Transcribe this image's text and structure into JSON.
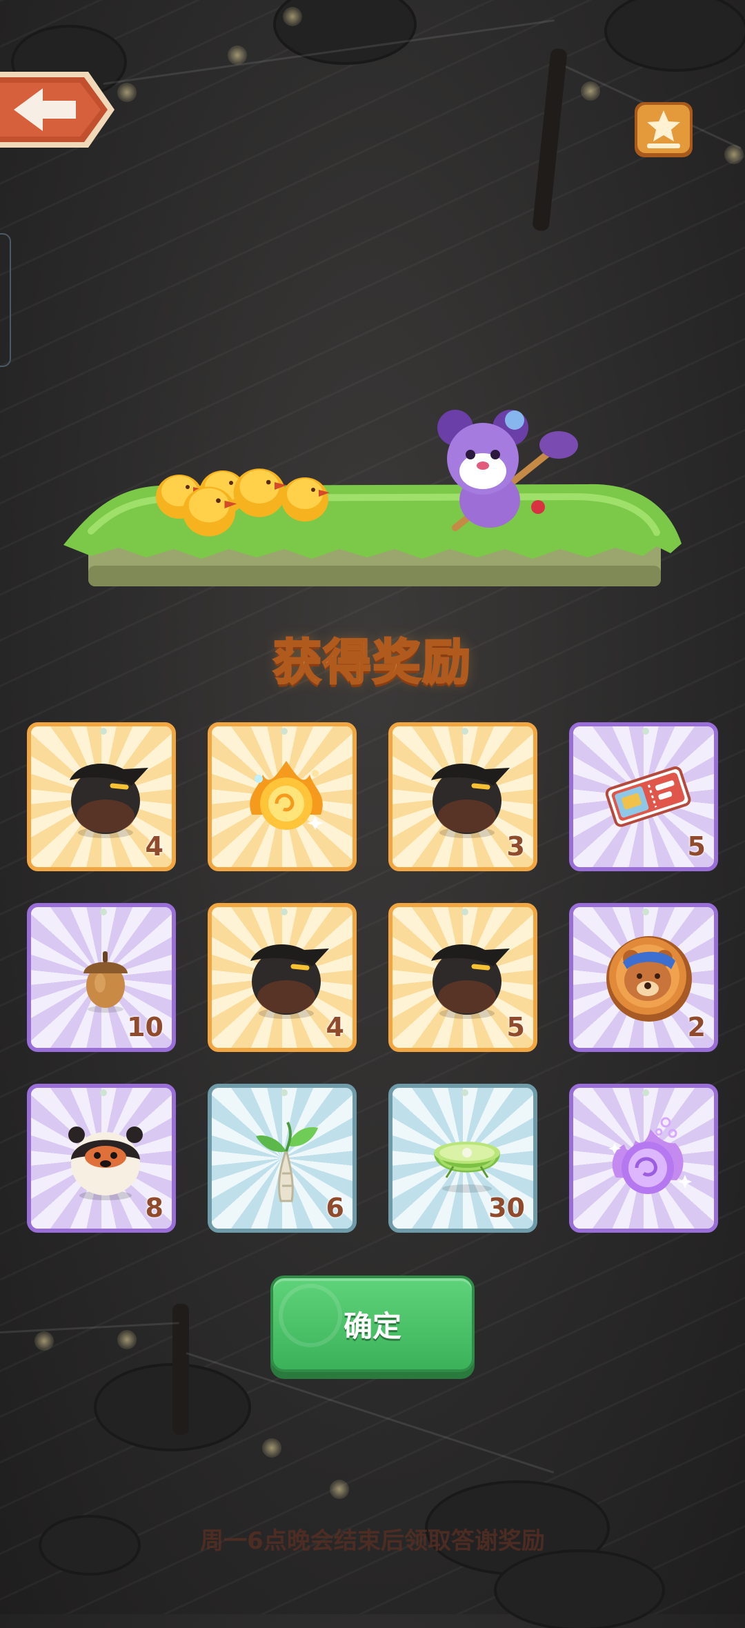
{
  "title": "获得奖励",
  "confirm_label": "确定",
  "footer_note": "周一6点晚会结束后领取答谢奖励",
  "colors": {
    "gold_border": "#f2a642",
    "purple_border": "#9a6ed8",
    "blue_border": "#6f9aa8",
    "confirm_green": "#4cc46a",
    "qty_text": "#8f4b2c"
  },
  "rewards": [
    {
      "icon": "black-bird-egg-icon",
      "tier": "gold",
      "qty": "4"
    },
    {
      "icon": "golden-flame-orb-icon",
      "tier": "gold",
      "qty": ""
    },
    {
      "icon": "black-bird-egg-icon",
      "tier": "gold",
      "qty": "3"
    },
    {
      "icon": "ticket-icon",
      "tier": "purple",
      "qty": "5"
    },
    {
      "icon": "acorn-icon",
      "tier": "purple",
      "qty": "10"
    },
    {
      "icon": "black-bird-egg-icon",
      "tier": "gold",
      "qty": "4"
    },
    {
      "icon": "black-bird-egg-icon",
      "tier": "gold",
      "qty": "5"
    },
    {
      "icon": "bear-coin-icon",
      "tier": "purple",
      "qty": "2"
    },
    {
      "icon": "panda-egg-icon",
      "tier": "purple",
      "qty": "8"
    },
    {
      "icon": "sprout-icon",
      "tier": "blue",
      "qty": "6"
    },
    {
      "icon": "lime-bowl-icon",
      "tier": "blue",
      "qty": "30"
    },
    {
      "icon": "purple-crystal-orb-icon",
      "tier": "purple",
      "qty": ""
    }
  ]
}
